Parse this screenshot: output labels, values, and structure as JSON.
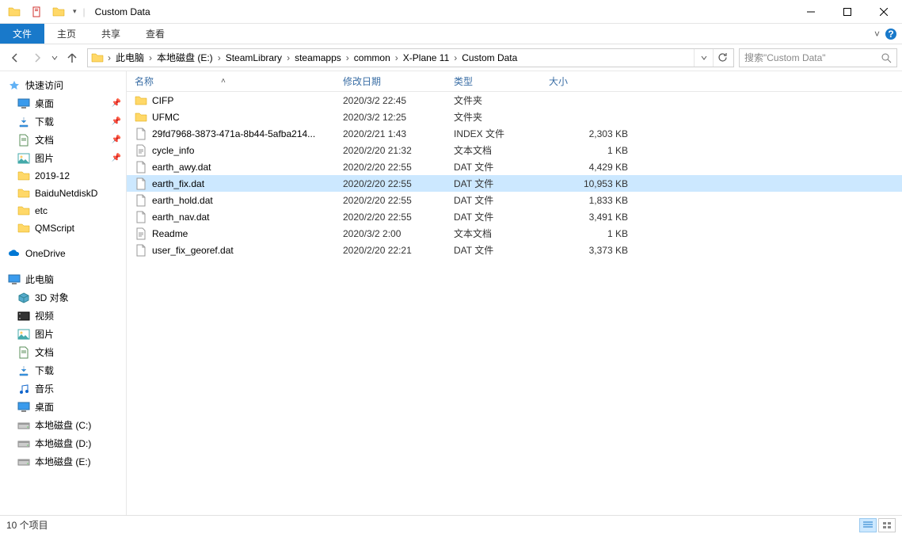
{
  "title": "Custom Data",
  "ribbon": {
    "file": "文件",
    "tabs": [
      "主页",
      "共享",
      "查看"
    ]
  },
  "breadcrumb": [
    "此电脑",
    "本地磁盘 (E:)",
    "SteamLibrary",
    "steamapps",
    "common",
    "X-Plane 11",
    "Custom Data"
  ],
  "search": {
    "placeholder": "搜索\"Custom Data\""
  },
  "columns": {
    "name": "名称",
    "date": "修改日期",
    "type": "类型",
    "size": "大小"
  },
  "sidebar": {
    "quick": "快速访问",
    "quick_items": [
      {
        "label": "桌面",
        "ico": "desktop",
        "pin": true
      },
      {
        "label": "下载",
        "ico": "download",
        "pin": true
      },
      {
        "label": "文档",
        "ico": "doc",
        "pin": true
      },
      {
        "label": "图片",
        "ico": "pic",
        "pin": true
      },
      {
        "label": "2019-12",
        "ico": "folder",
        "pin": false
      },
      {
        "label": "BaiduNetdiskD",
        "ico": "folder",
        "pin": false
      },
      {
        "label": "etc",
        "ico": "folder",
        "pin": false
      },
      {
        "label": "QMScript",
        "ico": "folder",
        "pin": false
      }
    ],
    "onedrive": "OneDrive",
    "thispc": "此电脑",
    "pc_items": [
      {
        "label": "3D 对象",
        "ico": "3d"
      },
      {
        "label": "视频",
        "ico": "video"
      },
      {
        "label": "图片",
        "ico": "pic"
      },
      {
        "label": "文档",
        "ico": "doc"
      },
      {
        "label": "下载",
        "ico": "download"
      },
      {
        "label": "音乐",
        "ico": "music"
      },
      {
        "label": "桌面",
        "ico": "desktop"
      },
      {
        "label": "本地磁盘 (C:)",
        "ico": "disk"
      },
      {
        "label": "本地磁盘 (D:)",
        "ico": "disk"
      },
      {
        "label": "本地磁盘 (E:)",
        "ico": "disk"
      }
    ]
  },
  "files": [
    {
      "name": "CIFP",
      "date": "2020/3/2 22:45",
      "type": "文件夹",
      "size": "",
      "ico": "folder"
    },
    {
      "name": "UFMC",
      "date": "2020/3/2 12:25",
      "type": "文件夹",
      "size": "",
      "ico": "folder"
    },
    {
      "name": "29fd7968-3873-471a-8b44-5afba214...",
      "date": "2020/2/21 1:43",
      "type": "INDEX 文件",
      "size": "2,303 KB",
      "ico": "file"
    },
    {
      "name": "cycle_info",
      "date": "2020/2/20 21:32",
      "type": "文本文档",
      "size": "1 KB",
      "ico": "txt"
    },
    {
      "name": "earth_awy.dat",
      "date": "2020/2/20 22:55",
      "type": "DAT 文件",
      "size": "4,429 KB",
      "ico": "file"
    },
    {
      "name": "earth_fix.dat",
      "date": "2020/2/20 22:55",
      "type": "DAT 文件",
      "size": "10,953 KB",
      "ico": "file",
      "selected": true
    },
    {
      "name": "earth_hold.dat",
      "date": "2020/2/20 22:55",
      "type": "DAT 文件",
      "size": "1,833 KB",
      "ico": "file"
    },
    {
      "name": "earth_nav.dat",
      "date": "2020/2/20 22:55",
      "type": "DAT 文件",
      "size": "3,491 KB",
      "ico": "file"
    },
    {
      "name": "Readme",
      "date": "2020/3/2 2:00",
      "type": "文本文档",
      "size": "1 KB",
      "ico": "txt"
    },
    {
      "name": "user_fix_georef.dat",
      "date": "2020/2/20 22:21",
      "type": "DAT 文件",
      "size": "3,373 KB",
      "ico": "file"
    }
  ],
  "status": "10 个项目"
}
